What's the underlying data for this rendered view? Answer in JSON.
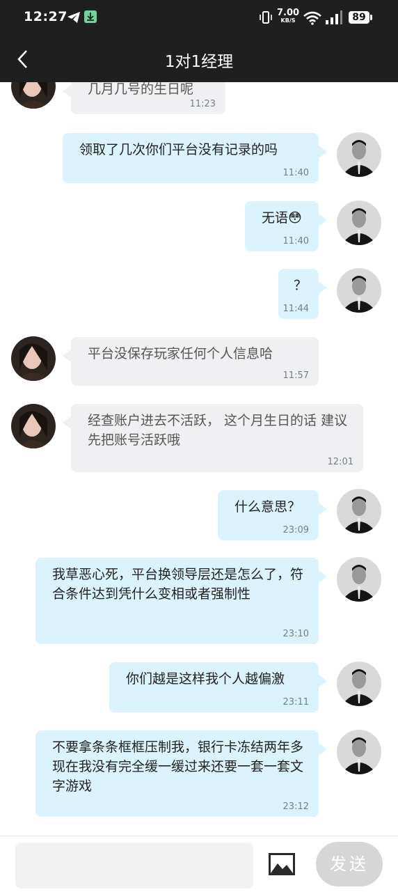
{
  "status_bar": {
    "time": "12:27",
    "net_speed": "7.00",
    "net_unit": "KB/S",
    "battery": "89"
  },
  "header": {
    "title": "1对1经理"
  },
  "messages": [
    {
      "side": "left",
      "text": "几月几号的生日呢",
      "time": "11:23"
    },
    {
      "side": "right",
      "text": "领取了几次你们平台没有记录的吗",
      "time": "11:40"
    },
    {
      "side": "right",
      "text": "无语😳",
      "time": "11:40"
    },
    {
      "side": "right",
      "text": "？",
      "time": "11:44"
    },
    {
      "side": "left",
      "text": "平台没保存玩家任何个人信息哈",
      "time": "11:57"
    },
    {
      "side": "left",
      "text": "经查账户进去不活跃， 这个月生日的话 建议先把账号活跃哦",
      "time": "12:01"
    },
    {
      "side": "right",
      "text": "什么意思？",
      "time": "23:09"
    },
    {
      "side": "right",
      "text": "我草恶心死，平台换领导层还是怎么了，符合条件达到凭什么变相或者强制性",
      "time": "23:10"
    },
    {
      "side": "right",
      "text": "你们越是这样我个人越偏激",
      "time": "23:11"
    },
    {
      "side": "right",
      "text": "不要拿条条框框压制我，银行卡冻结两年多现在我没有完全缓一缓过来还要一套一套文字游戏",
      "time": "23:12"
    }
  ],
  "input": {
    "placeholder": "",
    "send_label": "发送"
  },
  "icons": {
    "back": "chevron-left-icon",
    "image": "image-icon",
    "telegram": "telegram-icon",
    "download": "download-icon",
    "vibrate": "vibrate-icon",
    "wifi": "wifi-icon",
    "signal": "signal-icon"
  },
  "colors": {
    "header_bg": "#1f1f1f",
    "bubble_right": "#dbf3fc",
    "bubble_left": "#f0f0f2",
    "send_button": "#d6d6d6"
  }
}
